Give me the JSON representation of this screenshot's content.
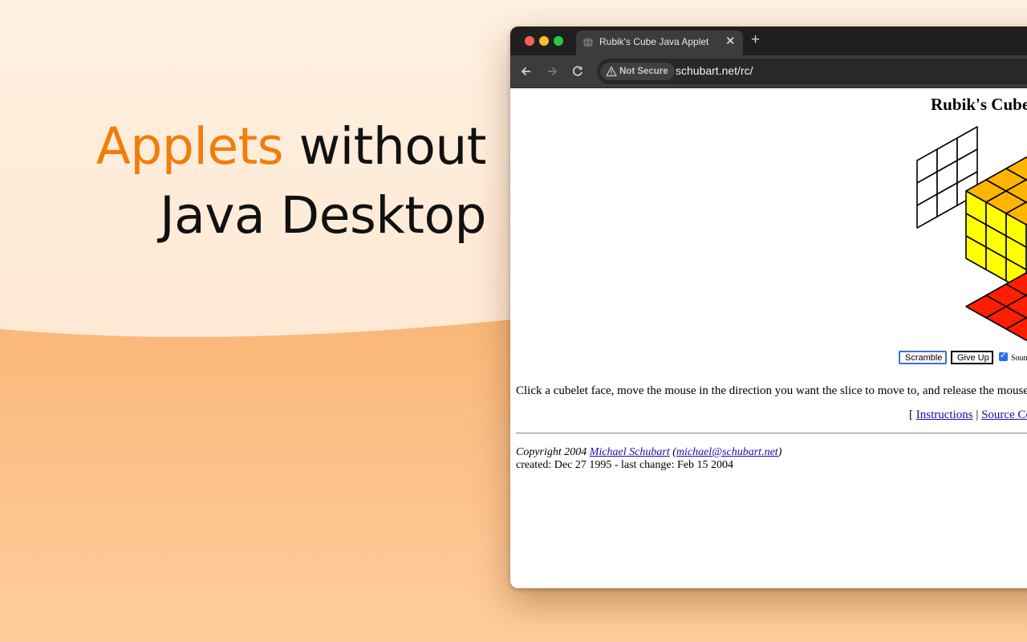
{
  "hero": {
    "headline_accent": "Applets",
    "headline_rest": "without",
    "headline_line2": "Java Desktop"
  },
  "browser": {
    "tab_title": "Rubik's Cube Java Applet",
    "security_label": "Not Secure",
    "url": "schubart.net/rc/"
  },
  "page": {
    "title": "Rubik's Cube",
    "scramble_label": "Scramble",
    "giveup_label": "Give Up",
    "sound_label": "Sound",
    "sound_checked": true,
    "instructions_text": "Click a cubelet face, move the mouse in the direction you want the slice to move to, and release the mouse button",
    "links_open": "[ ",
    "link_instructions": "Instructions",
    "links_sep": " | ",
    "link_source": "Source Code",
    "copyright_prefix": "Copyright 2004 ",
    "author_name": "Michael Schubart",
    "author_open": " (",
    "author_email": "michael@schubart.net",
    "author_close": ")",
    "dates": "created: Dec 27 1995 - last change: Feb 15 2004"
  },
  "colors": {
    "accent": "#f27d0c",
    "cube_yellow": "#ffff00",
    "cube_orange": "#ffb400",
    "cube_red": "#ff1e00"
  }
}
